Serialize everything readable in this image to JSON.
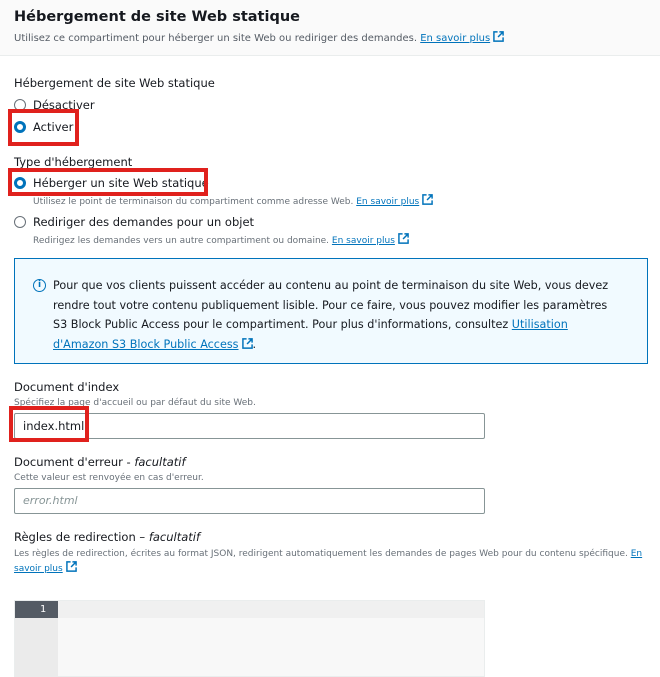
{
  "header": {
    "title": "Hébergement de site Web statique",
    "subtitle": "Utilisez ce compartiment pour héberger un site Web ou rediriger des demandes.",
    "learn_more": "En savoir plus"
  },
  "hosting": {
    "label": "Hébergement de site Web statique",
    "options": [
      {
        "label": "Désactiver",
        "checked": false
      },
      {
        "label": "Activer",
        "checked": true
      }
    ]
  },
  "hosting_type": {
    "label": "Type d'hébergement",
    "options": [
      {
        "label": "Héberger un site Web statique",
        "checked": true,
        "description": "Utilisez le point de terminaison du compartiment comme adresse Web.",
        "learn_more": "En savoir plus"
      },
      {
        "label": "Rediriger des demandes pour un objet",
        "checked": false,
        "description": "Redirigez les demandes vers un autre compartiment ou domaine.",
        "learn_more": "En savoir plus"
      }
    ]
  },
  "info": {
    "text": "Pour que vos clients puissent accéder au contenu au point de terminaison du site Web, vous devez rendre tout votre contenu publiquement lisible. Pour ce faire, vous pouvez modifier les paramètres S3 Block Public Access pour le compartiment. Pour plus d'informations, consultez ",
    "link": "Utilisation d'Amazon S3 Block Public Access",
    "end": "."
  },
  "index_doc": {
    "label": "Document d'index",
    "description": "Spécifiez la page d'accueil ou par défaut du site Web.",
    "value": "index.html"
  },
  "error_doc": {
    "label": "Document d'erreur - ",
    "optional": "facultatif",
    "description": "Cette valeur est renvoyée en cas d'erreur.",
    "placeholder": "error.html"
  },
  "redirect_rules": {
    "label": "Règles de redirection – ",
    "optional": "facultatif",
    "description": "Les règles de redirection, écrites au format JSON, redirigent automatiquement les demandes de pages Web pour du contenu spécifique. ",
    "learn_more": "En savoir plus",
    "line_number": "1"
  },
  "colors": {
    "accent": "#0073bb",
    "highlight": "#e0211d",
    "info_bg": "#f1faff"
  },
  "icons": [
    "external-link-icon",
    "info-icon"
  ]
}
